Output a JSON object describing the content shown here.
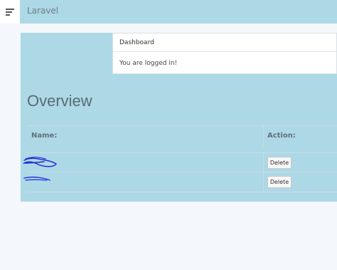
{
  "navbar": {
    "brand": "Laravel",
    "menu_icon": "hamburger-icon"
  },
  "dashboard_card": {
    "header": "Dashboard",
    "body": "You are logged in!"
  },
  "overview": {
    "title": "Overview",
    "columns": [
      "Name:",
      "Action:"
    ],
    "rows": [
      {
        "name": "",
        "action_label": "Delete"
      },
      {
        "name": "",
        "action_label": "Delete"
      }
    ]
  },
  "colors": {
    "navbar_bg": "#add8e6",
    "content_bg": "#add8e6",
    "page_bg": "#f4f7fb",
    "scribble": "#1f2bd8"
  }
}
